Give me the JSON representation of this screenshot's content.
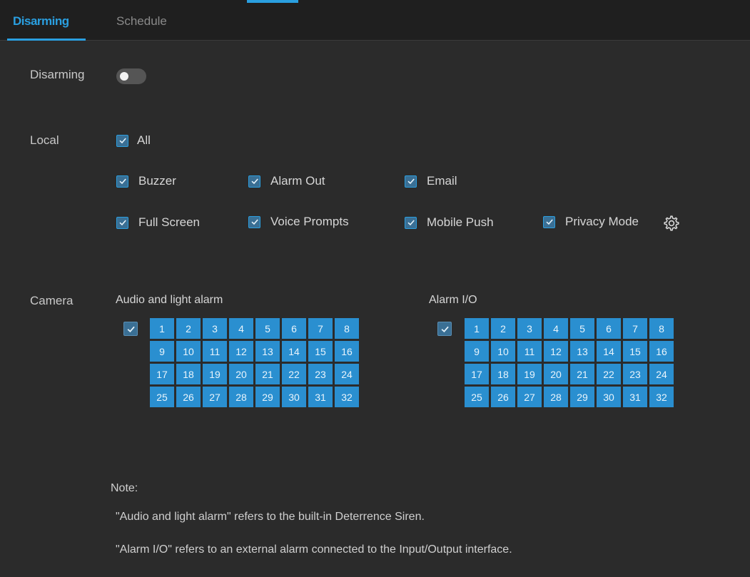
{
  "tabs": [
    {
      "label": "Disarming",
      "active": true
    },
    {
      "label": "Schedule",
      "active": false
    }
  ],
  "disarming": {
    "label": "Disarming",
    "enabled": false
  },
  "local": {
    "label": "Local",
    "all": {
      "label": "All",
      "checked": true
    },
    "options": [
      {
        "label": "Buzzer",
        "checked": true
      },
      {
        "label": "Alarm Out",
        "checked": true
      },
      {
        "label": "Email",
        "checked": true
      },
      {
        "label": "Full Screen",
        "checked": true
      },
      {
        "label": "Voice Prompts",
        "checked": true
      },
      {
        "label": "Mobile Push",
        "checked": true
      },
      {
        "label": "Privacy Mode",
        "checked": true
      }
    ],
    "settings_icon": "gear-icon"
  },
  "camera": {
    "label": "Camera",
    "groups": [
      {
        "title": "Audio and light alarm",
        "all_checked": true,
        "channels": [
          "1",
          "2",
          "3",
          "4",
          "5",
          "6",
          "7",
          "8",
          "9",
          "10",
          "11",
          "12",
          "13",
          "14",
          "15",
          "16",
          "17",
          "18",
          "19",
          "20",
          "21",
          "22",
          "23",
          "24",
          "25",
          "26",
          "27",
          "28",
          "29",
          "30",
          "31",
          "32"
        ]
      },
      {
        "title": "Alarm I/O",
        "all_checked": true,
        "channels": [
          "1",
          "2",
          "3",
          "4",
          "5",
          "6",
          "7",
          "8",
          "9",
          "10",
          "11",
          "12",
          "13",
          "14",
          "15",
          "16",
          "17",
          "18",
          "19",
          "20",
          "21",
          "22",
          "23",
          "24",
          "25",
          "26",
          "27",
          "28",
          "29",
          "30",
          "31",
          "32"
        ]
      }
    ]
  },
  "notes": {
    "title": "Note:",
    "line1": "\"Audio and light alarm\" refers to the built-in Deterrence Siren.",
    "line2": "\"Alarm I/O\" refers to an external alarm connected to the Input/Output interface."
  },
  "colors": {
    "accent": "#2a9fe0",
    "channel_bg": "#2a8fd0",
    "background": "#2b2b2b"
  }
}
